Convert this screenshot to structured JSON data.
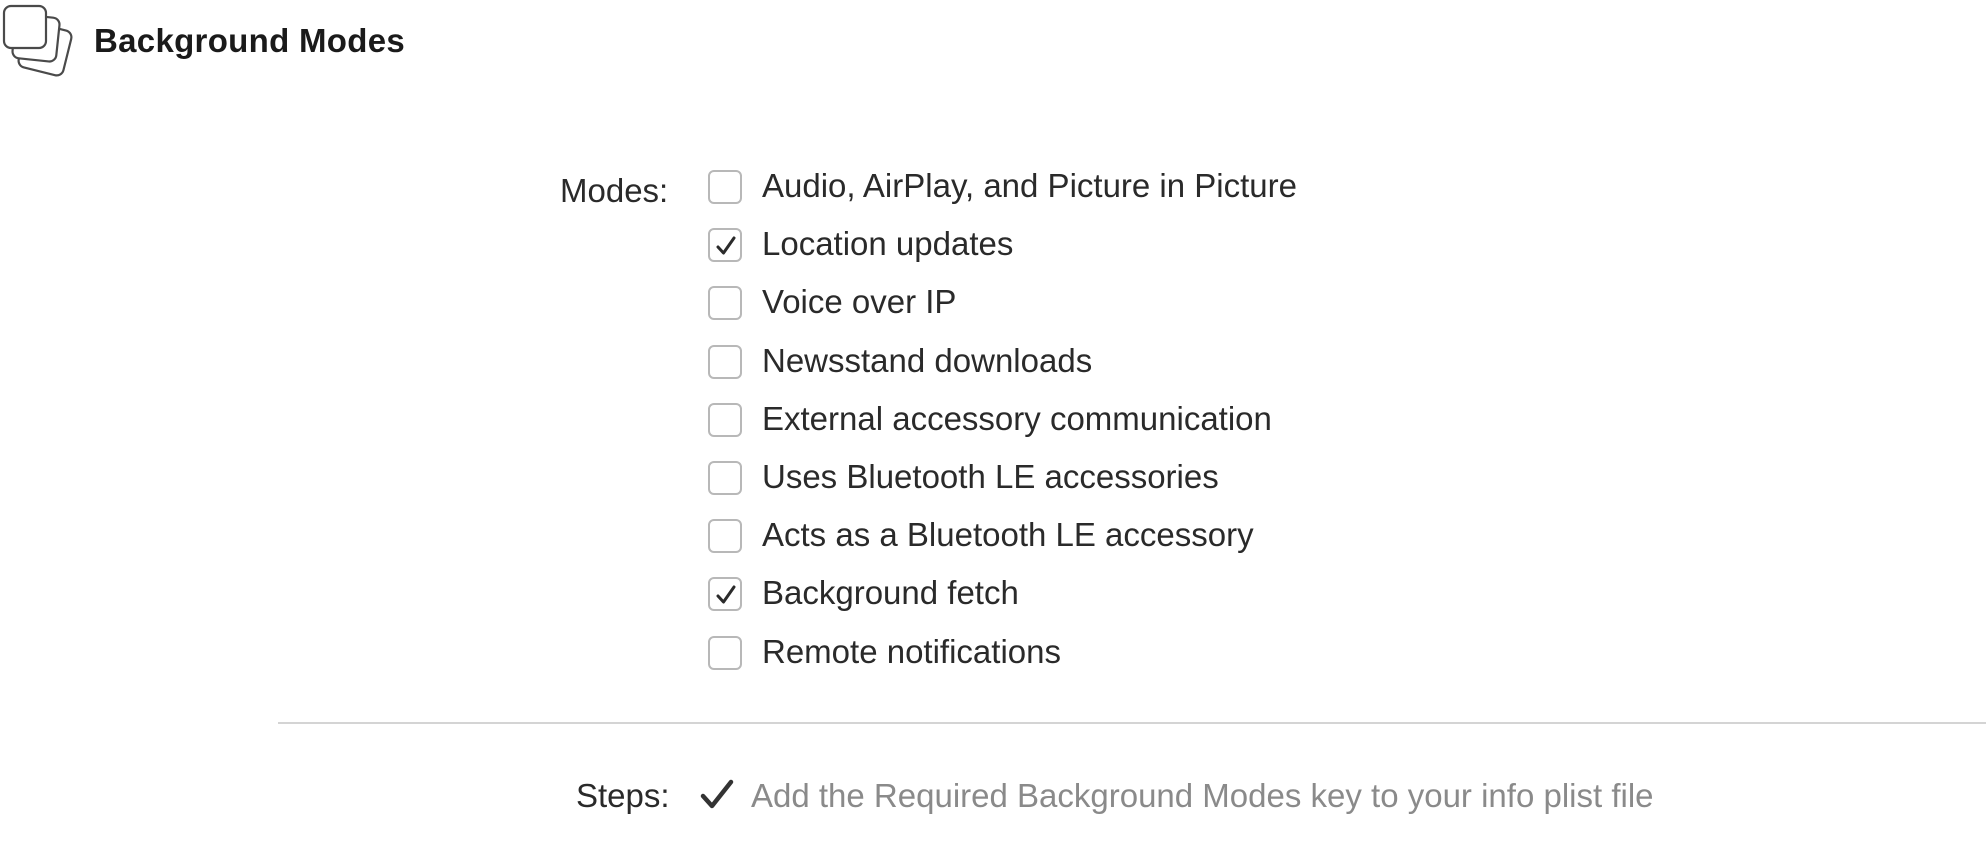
{
  "section": {
    "title": "Background Modes",
    "icon": "background-modes-icon"
  },
  "modes": {
    "label": "Modes:",
    "items": [
      {
        "label": "Audio, AirPlay, and Picture in Picture",
        "checked": false
      },
      {
        "label": "Location updates",
        "checked": true
      },
      {
        "label": "Voice over IP",
        "checked": false
      },
      {
        "label": "Newsstand downloads",
        "checked": false
      },
      {
        "label": "External accessory communication",
        "checked": false
      },
      {
        "label": "Uses Bluetooth LE accessories",
        "checked": false
      },
      {
        "label": "Acts as a Bluetooth LE accessory",
        "checked": false
      },
      {
        "label": "Background fetch",
        "checked": true
      },
      {
        "label": "Remote notifications",
        "checked": false
      }
    ]
  },
  "steps": {
    "label": "Steps:",
    "items": [
      {
        "text": "Add the Required Background Modes key to your info plist file",
        "done": true
      }
    ]
  }
}
